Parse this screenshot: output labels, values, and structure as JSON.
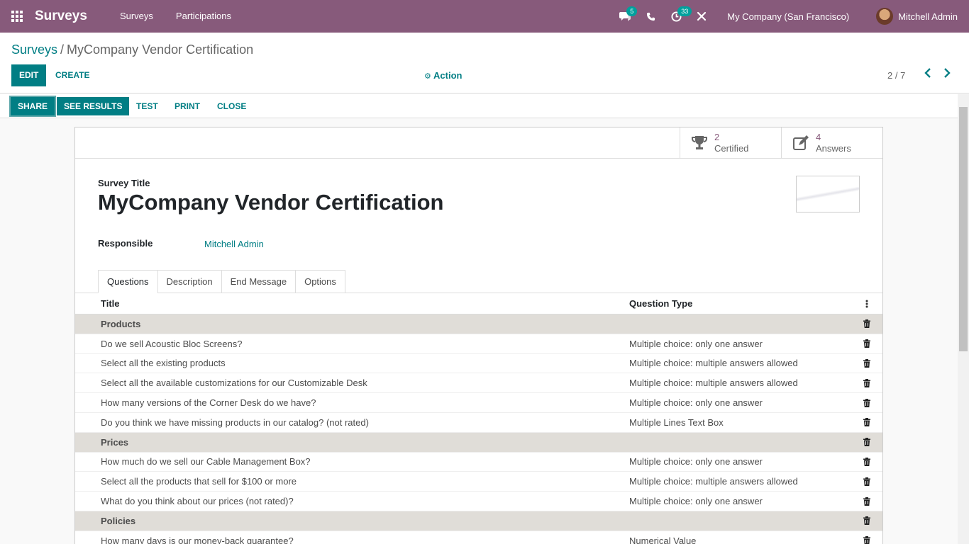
{
  "navbar": {
    "brand": "Surveys",
    "menus": [
      "Surveys",
      "Participations"
    ],
    "chat_badge": "5",
    "activity_badge": "33",
    "company": "My Company (San Francisco)",
    "user": "Mitchell Admin"
  },
  "breadcrumb": {
    "parent": "Surveys",
    "separator": "/",
    "current": "MyCompany Vendor Certification"
  },
  "control": {
    "edit": "EDIT",
    "create": "CREATE",
    "action": "Action",
    "pager": "2 / 7"
  },
  "statusbar": {
    "share": "SHARE",
    "see_results": "SEE RESULTS",
    "test": "TEST",
    "print": "PRINT",
    "close": "CLOSE"
  },
  "stats": {
    "certified_value": "2",
    "certified_label": "Certified",
    "answers_value": "4",
    "answers_label": "Answers"
  },
  "form": {
    "title_label": "Survey Title",
    "title": "MyCompany Vendor Certification",
    "responsible_label": "Responsible",
    "responsible": "Mitchell Admin"
  },
  "tabs": [
    "Questions",
    "Description",
    "End Message",
    "Options"
  ],
  "list": {
    "headers": {
      "title": "Title",
      "type": "Question Type"
    },
    "rows": [
      {
        "title": "Products",
        "type": "",
        "section": true
      },
      {
        "title": "Do we sell Acoustic Bloc Screens?",
        "type": "Multiple choice: only one answer",
        "section": false
      },
      {
        "title": "Select all the existing products",
        "type": "Multiple choice: multiple answers allowed",
        "section": false
      },
      {
        "title": "Select all the available customizations for our Customizable Desk",
        "type": "Multiple choice: multiple answers allowed",
        "section": false
      },
      {
        "title": "How many versions of the Corner Desk do we have?",
        "type": "Multiple choice: only one answer",
        "section": false
      },
      {
        "title": "Do you think we have missing products in our catalog? (not rated)",
        "type": "Multiple Lines Text Box",
        "section": false
      },
      {
        "title": "Prices",
        "type": "",
        "section": true
      },
      {
        "title": "How much do we sell our Cable Management Box?",
        "type": "Multiple choice: only one answer",
        "section": false
      },
      {
        "title": "Select all the products that sell for $100 or more",
        "type": "Multiple choice: multiple answers allowed",
        "section": false
      },
      {
        "title": "What do you think about our prices (not rated)?",
        "type": "Multiple choice: only one answer",
        "section": false
      },
      {
        "title": "Policies",
        "type": "",
        "section": true
      },
      {
        "title": "How many days is our money-back guarantee?",
        "type": "Numerical Value",
        "section": false
      }
    ]
  },
  "colors": {
    "navbar": "#875a7b",
    "primary": "#017e84",
    "section_bg": "#e0ddd8"
  }
}
